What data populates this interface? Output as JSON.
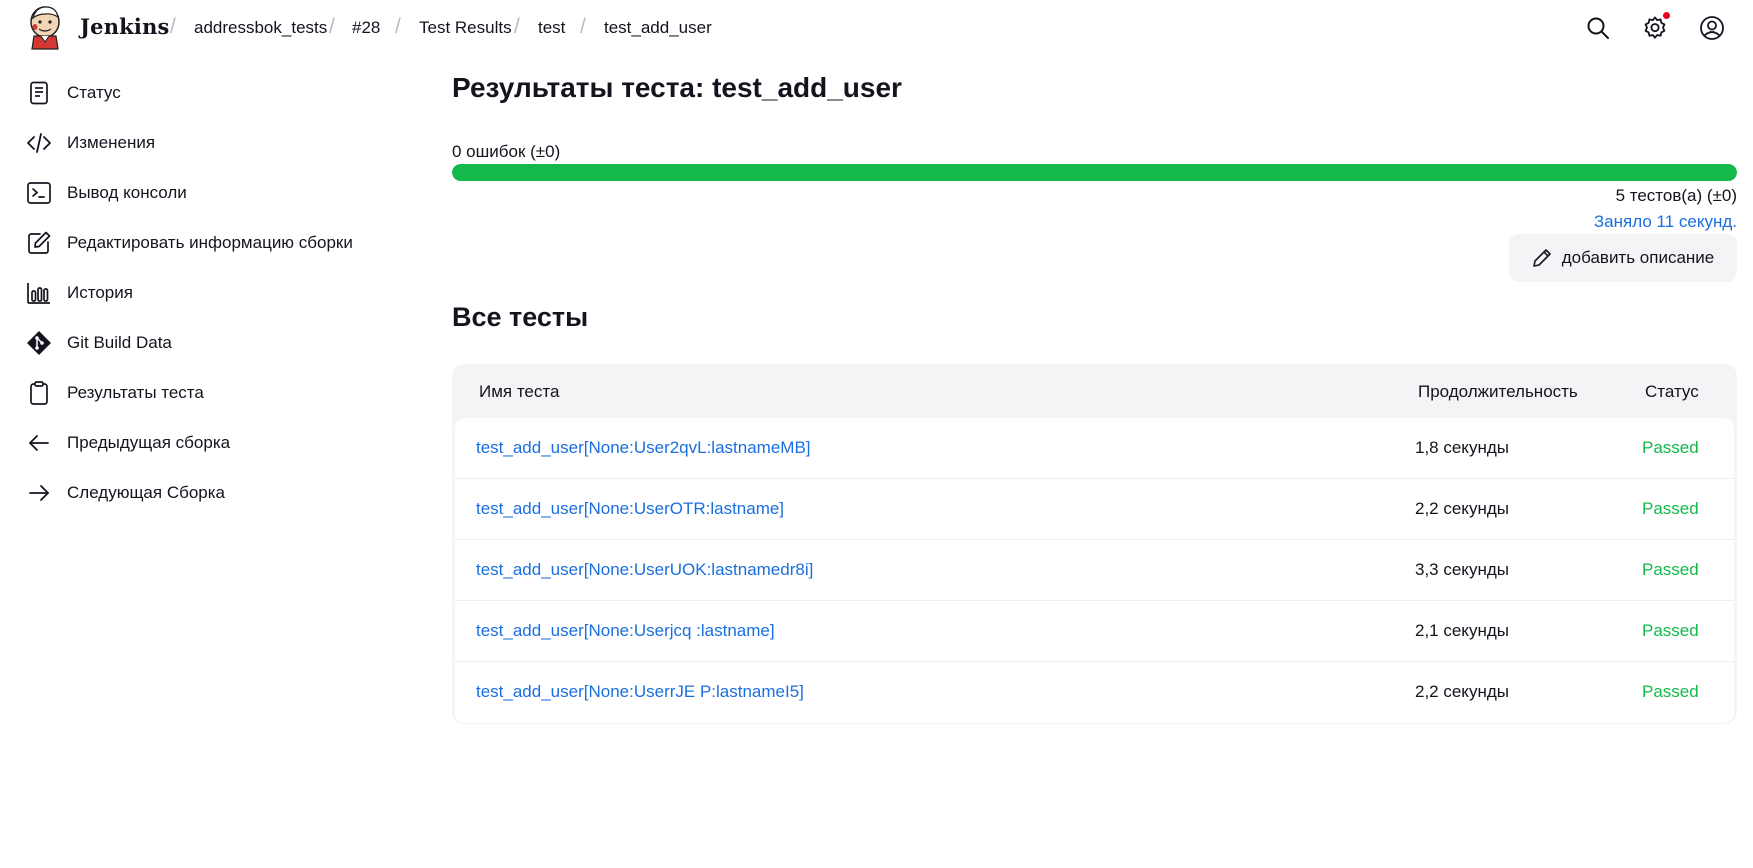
{
  "header": {
    "brand": "Jenkins",
    "breadcrumbs": [
      "addressbok_tests",
      "#28",
      "Test Results",
      "test",
      "test_add_user"
    ],
    "separator": "/",
    "icons": [
      "search-icon",
      "settings-icon",
      "user-icon"
    ]
  },
  "sidebar": {
    "items": [
      {
        "label": "Статус",
        "icon": "status-icon"
      },
      {
        "label": "Изменения",
        "icon": "code-icon"
      },
      {
        "label": "Вывод консоли",
        "icon": "terminal-icon"
      },
      {
        "label": "Редактировать информацию сборки",
        "icon": "edit-icon"
      },
      {
        "label": "История",
        "icon": "history-icon"
      },
      {
        "label": "Git Build Data",
        "icon": "git-icon"
      },
      {
        "label": "Результаты теста",
        "icon": "clipboard-icon"
      },
      {
        "label": "Предыдущая сборка",
        "icon": "arrow-left-icon"
      },
      {
        "label": "Следующая Сборка",
        "icon": "arrow-right-icon"
      }
    ]
  },
  "main": {
    "title": "Результаты теста: test_add_user",
    "failures": "0 ошибок (±0)",
    "pass_ratio": 1.0,
    "tests_count": "5 тестов(а) (±0)",
    "took": "Заняло 11 секунд.",
    "add_description": "добавить описание",
    "section_title": "Все тесты",
    "table": {
      "headers": [
        "Имя теста",
        "Продолжительность",
        "Статус"
      ],
      "rows": [
        {
          "name": "test_add_user[None:User2qvL:lastnameMB]",
          "duration": "1,8 секунды",
          "status": "Passed"
        },
        {
          "name": "test_add_user[None:UserOTR:lastname]",
          "duration": "2,2 секунды",
          "status": "Passed"
        },
        {
          "name": "test_add_user[None:UserUOK:lastnamedr8i]",
          "duration": "3,3 секунды",
          "status": "Passed"
        },
        {
          "name": "test_add_user[None:Userjcq :lastname]",
          "duration": "2,1 секунды",
          "status": "Passed"
        },
        {
          "name": "test_add_user[None:UserrJE P:lastnameI5]",
          "duration": "2,2 секунды",
          "status": "Passed"
        }
      ]
    }
  },
  "colors": {
    "accent": "#1a6fe0",
    "success": "#14b84b",
    "notification": "#e6001f"
  }
}
